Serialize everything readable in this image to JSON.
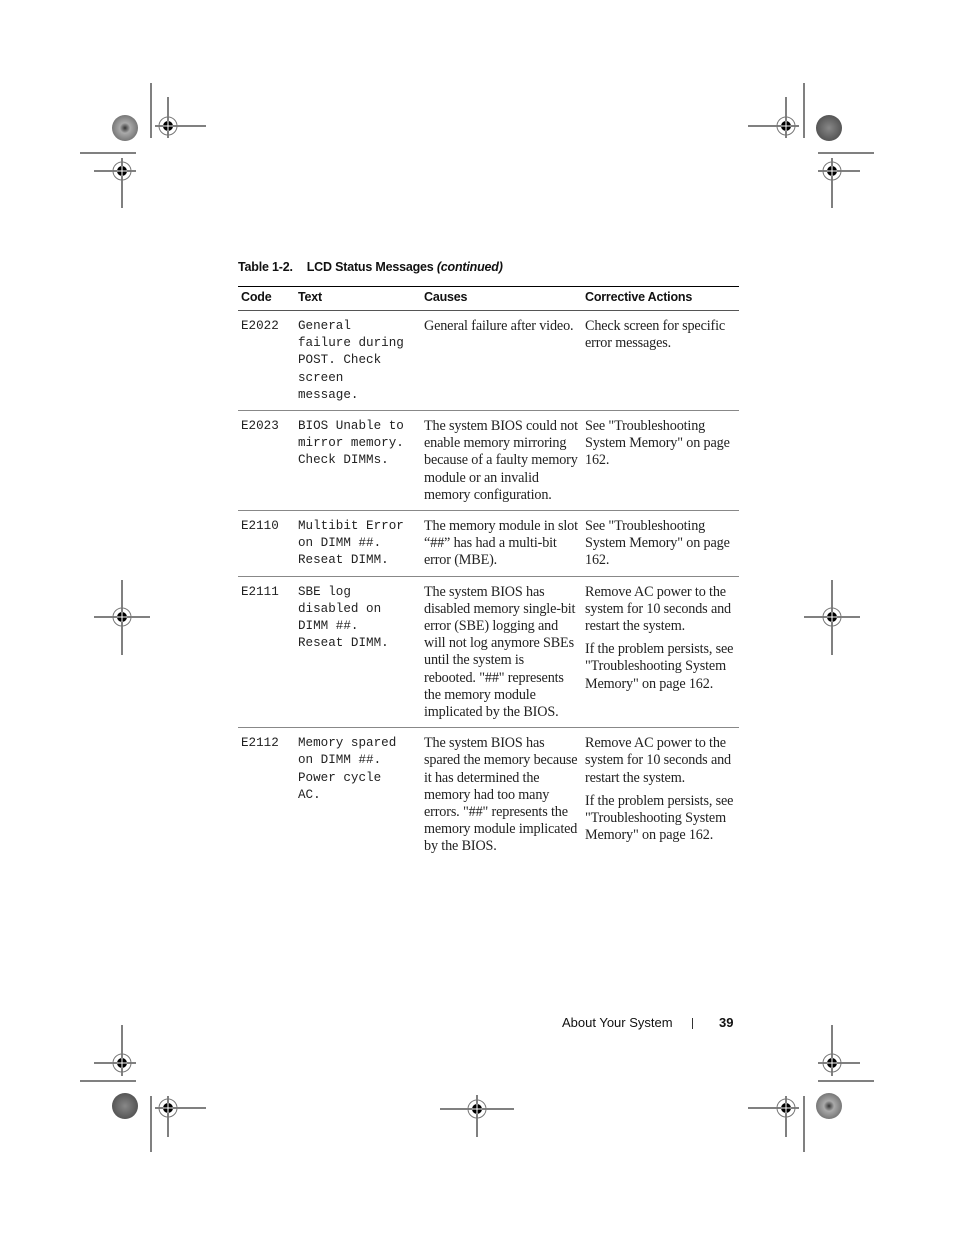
{
  "table": {
    "number": "Table 1-2.",
    "title": "LCD Status Messages",
    "continued": "(continued)",
    "headers": [
      "Code",
      "Text",
      "Causes",
      "Corrective Actions"
    ],
    "rows": [
      {
        "code": "E2022",
        "text": "General\nfailure during\nPOST. Check\nscreen\nmessage.",
        "cause": "General failure after video.",
        "actions": [
          "Check screen for specific error messages."
        ]
      },
      {
        "code": "E2023",
        "text": "BIOS Unable to\nmirror memory.\nCheck DIMMs.",
        "cause": "The system BIOS could not enable memory mirroring because of a faulty memory module or an invalid memory configuration.",
        "actions": [
          "See \"Troubleshooting System Memory\" on page 162."
        ]
      },
      {
        "code": "E2110",
        "text": "Multibit Error\non DIMM ##.\nReseat DIMM.",
        "cause": "The memory module in slot “##” has had a multi-bit error (MBE).",
        "actions": [
          "See \"Troubleshooting System Memory\" on page 162."
        ]
      },
      {
        "code": "E2111",
        "text": "SBE log\ndisabled on\nDIMM ##.\nReseat DIMM.",
        "cause": "The system BIOS has disabled memory single-bit error (SBE) logging and will not log anymore SBEs until the system is rebooted. \"##\" represents the memory module implicated by the BIOS.",
        "actions": [
          "Remove AC power to the system for 10 seconds and restart the system.",
          "If the problem persists, see \"Troubleshooting System Memory\" on page 162."
        ]
      },
      {
        "code": "E2112",
        "text": "Memory spared\non DIMM ##.\nPower cycle\nAC.",
        "cause": "The system BIOS has spared the memory because it has determined the memory had too many errors. \"##\" represents the memory module implicated by the BIOS.",
        "actions": [
          "Remove AC power to the system for 10 seconds and restart the system.",
          "If the problem persists, see \"Troubleshooting System Memory\" on page 162."
        ]
      }
    ]
  },
  "footer": {
    "section": "About Your System",
    "page_number": "39"
  }
}
